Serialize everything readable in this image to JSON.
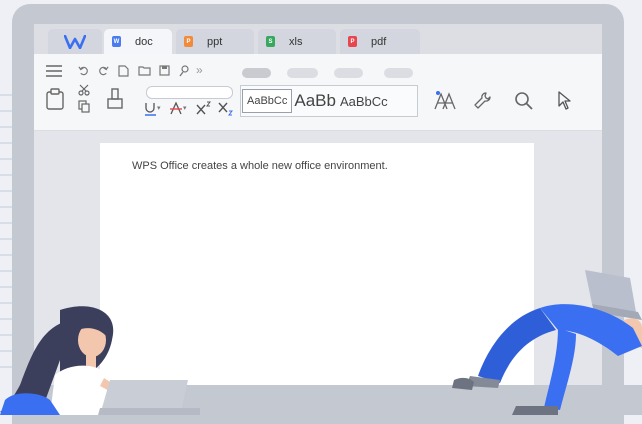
{
  "tabs": [
    {
      "label": "doc",
      "icon": "doc-file-icon",
      "color": "#4a7cf0"
    },
    {
      "label": "ppt",
      "icon": "ppt-file-icon",
      "color": "#f28a3c"
    },
    {
      "label": "xls",
      "icon": "xls-file-icon",
      "color": "#37a85e"
    },
    {
      "label": "pdf",
      "icon": "pdf-file-icon",
      "color": "#e8464e"
    }
  ],
  "styles": [
    "AaBbCc",
    "AaBb",
    "AaBbCc"
  ],
  "document": {
    "text": "WPS Office creates a whole new office environment."
  },
  "colors": {
    "brand": "#3a6ff2",
    "accent_tool": "#3a6ff2",
    "person_shirt_blue": "#3a6ff2",
    "person_hair": "#3b3f5c"
  }
}
